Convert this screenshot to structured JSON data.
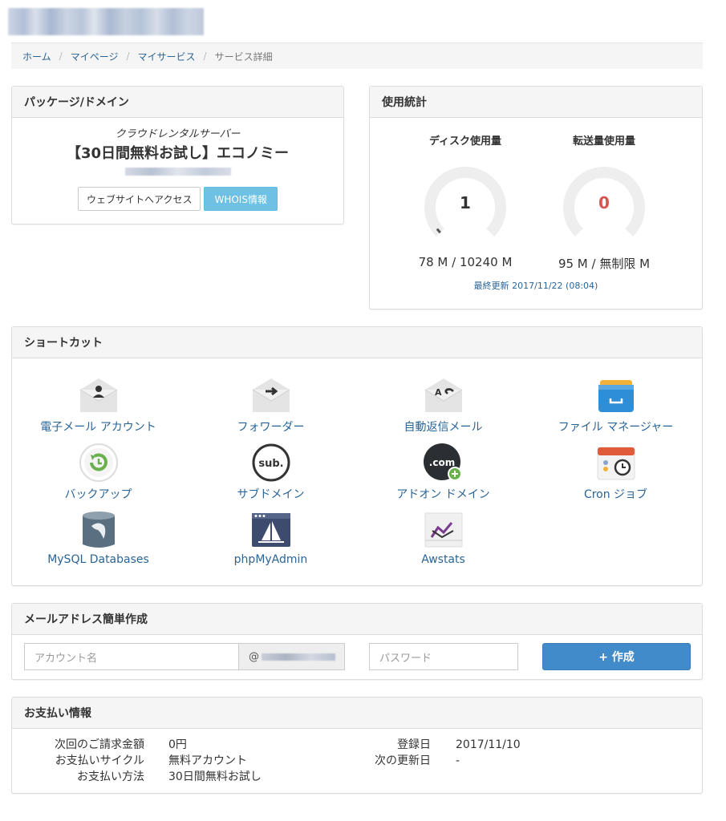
{
  "breadcrumb": [
    "ホーム",
    "マイページ",
    "マイサービス",
    "サービス詳細"
  ],
  "package": {
    "title": "パッケージ/ドメイン",
    "plan": "クラウドレンタルサーバー",
    "name": "【30日間無料お試し】エコノミー",
    "visit_button": "ウェブサイトへアクセス",
    "whois_button": "WHOIS情報"
  },
  "stats": {
    "title": "使用統計",
    "disk": {
      "title": "ディスク使用量",
      "value": "1",
      "usage": "78 M / 10240 M",
      "percent": 0.76,
      "color": "#333333"
    },
    "transfer": {
      "title": "転送量使用量",
      "value": "0",
      "usage": "95 M / 無制限 M",
      "percent": 0,
      "color": "#d9534f"
    },
    "updated": "最終更新 2017/11/22 (08:04)"
  },
  "shortcuts": {
    "title": "ショートカット",
    "items": [
      {
        "label": "電子メール アカウント",
        "icon": "email-account-icon"
      },
      {
        "label": "フォワーダー",
        "icon": "forwarder-icon"
      },
      {
        "label": "自動返信メール",
        "icon": "autoresponder-icon"
      },
      {
        "label": "ファイル マネージャー",
        "icon": "file-manager-icon"
      },
      {
        "label": "バックアップ",
        "icon": "backup-icon"
      },
      {
        "label": "サブドメイン",
        "icon": "subdomain-icon"
      },
      {
        "label": "アドオン ドメイン",
        "icon": "addon-domain-icon"
      },
      {
        "label": "Cron ジョブ",
        "icon": "cron-icon"
      },
      {
        "label": "MySQL Databases",
        "icon": "mysql-icon"
      },
      {
        "label": "phpMyAdmin",
        "icon": "phpmyadmin-icon"
      },
      {
        "label": "Awstats",
        "icon": "awstats-icon"
      }
    ]
  },
  "mail": {
    "title": "メールアドレス簡単作成",
    "account_placeholder": "アカウント名",
    "at": "@",
    "password_placeholder": "パスワード",
    "create_button": "+ 作成"
  },
  "billing": {
    "title": "お支払い情報",
    "left": [
      {
        "label": "次回のご請求金額",
        "value": "0円"
      },
      {
        "label": "お支払いサイクル",
        "value": "無料アカウント"
      },
      {
        "label": "お支払い方法",
        "value": "30日間無料お試し"
      }
    ],
    "right": [
      {
        "label": "登録日",
        "value": "2017/11/10"
      },
      {
        "label": "次の更新日",
        "value": "-"
      }
    ]
  }
}
